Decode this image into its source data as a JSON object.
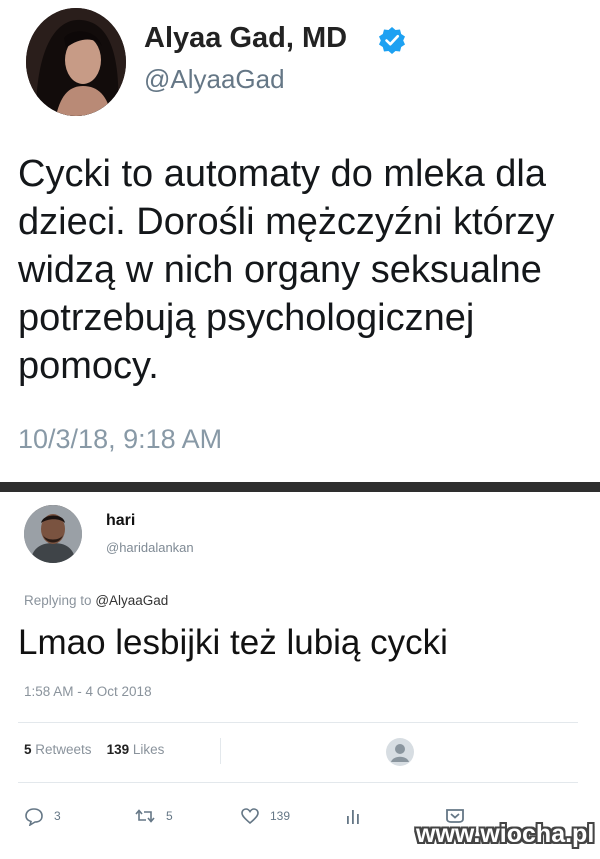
{
  "tweet1": {
    "name": "Alyaa Gad, MD",
    "handle": "@AlyaaGad",
    "text": "Cycki to automaty do mleka dla dzieci. Dorośli mężczyźni którzy widzą w nich organy seksualne potrzebują psychologicznej pomocy.",
    "timestamp": "10/3/18, 9:18 AM",
    "verified_icon": "verified-badge-icon",
    "accent_color": "#1da1f2"
  },
  "tweet2": {
    "name": "hari",
    "handle": "@haridalankan",
    "replying_prefix": "Replying to",
    "replying_handle": "@AlyaaGad",
    "text": "Lmao lesbijki też lubią cycki",
    "timestamp": "1:58 AM - 4 Oct 2018",
    "stats": {
      "retweets_count": "5",
      "retweets_label": "Retweets",
      "likes_count": "139",
      "likes_label": "Likes"
    },
    "actions": {
      "reply_count": "3",
      "retweet_count": "5",
      "like_count": "139"
    }
  },
  "watermark": "www.wiocha.pl"
}
